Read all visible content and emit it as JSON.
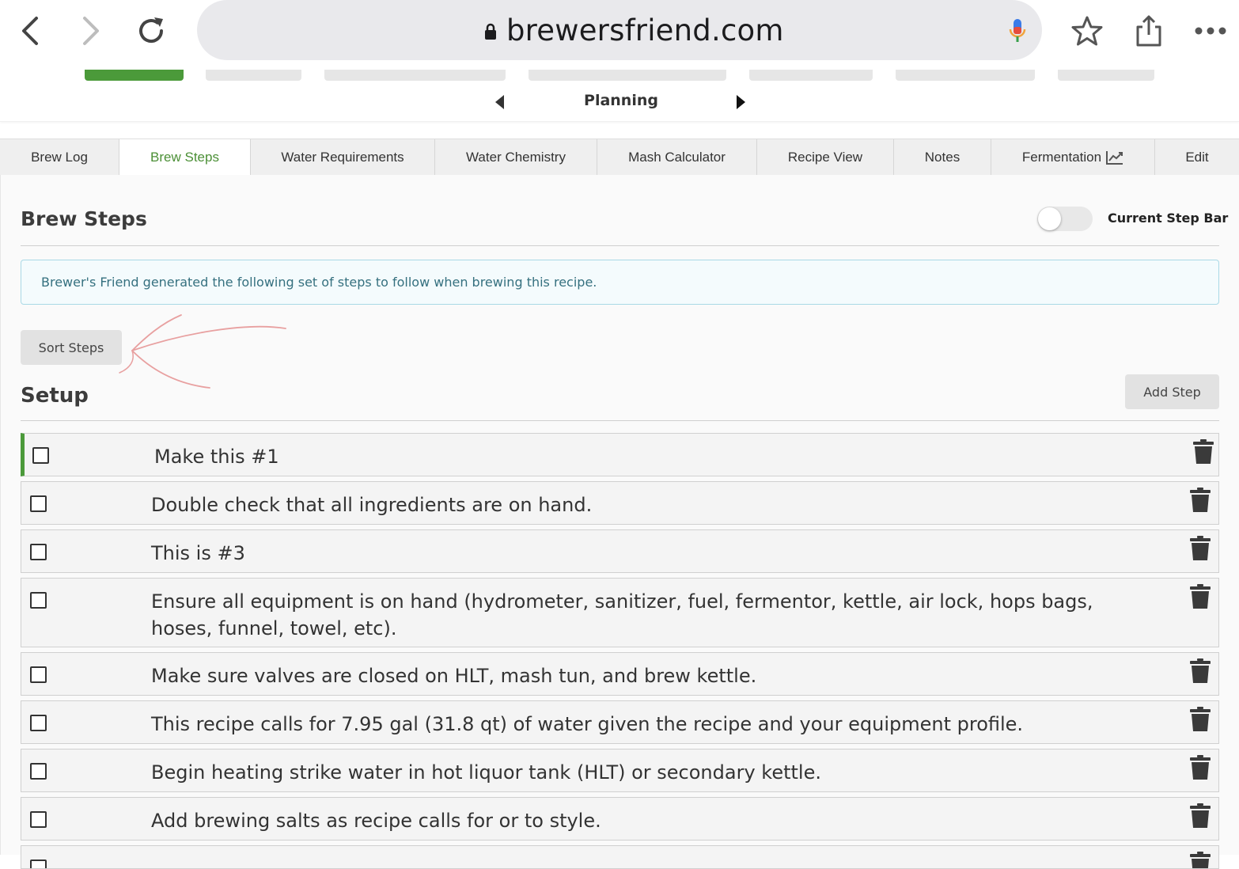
{
  "browser": {
    "url": "brewersfriend.com",
    "icons": [
      "back-icon",
      "forward-icon",
      "reload-icon",
      "lock-icon",
      "microphone-icon",
      "bookmark-star-icon",
      "share-icon",
      "more-icon"
    ]
  },
  "progress": {
    "current_stage": "Planning"
  },
  "tabs": [
    {
      "label": "Brew Log",
      "active": false
    },
    {
      "label": "Brew Steps",
      "active": true
    },
    {
      "label": "Water Requirements",
      "active": false
    },
    {
      "label": "Water Chemistry",
      "active": false
    },
    {
      "label": "Mash Calculator",
      "active": false
    },
    {
      "label": "Recipe View",
      "active": false
    },
    {
      "label": "Notes",
      "active": false
    },
    {
      "label": "Fermentation",
      "active": false,
      "icon": "chart-icon"
    },
    {
      "label": "Edit",
      "active": false
    }
  ],
  "page": {
    "title": "Brew Steps",
    "toggle_label": "Current Step Bar",
    "toggle_on": false,
    "info": "Brewer's Friend generated the following set of steps to follow when brewing this recipe.",
    "sort_button": "Sort Steps",
    "add_button": "Add Step",
    "section_title": "Setup"
  },
  "steps": [
    {
      "text": "Make this #1",
      "checked": false
    },
    {
      "text": "Double check that all ingredients are on hand.",
      "checked": false
    },
    {
      "text": "This is #3",
      "checked": false
    },
    {
      "text": "Ensure all equipment is on hand (hydrometer, sanitizer, fuel, fermentor, kettle, air lock, hops bags, hoses, funnel, towel, etc).",
      "checked": false
    },
    {
      "text": "Make sure valves are closed on HLT, mash tun, and brew kettle.",
      "checked": false
    },
    {
      "text": "This recipe calls for 7.95 gal (31.8 qt) of water given the recipe and your equipment profile.",
      "checked": false
    },
    {
      "text": "Begin heating strike water in hot liquor tank (HLT) or secondary kettle.",
      "checked": false
    },
    {
      "text": "Add brewing salts as recipe calls for or to style.",
      "checked": false
    }
  ],
  "colors": {
    "accent_green": "#4b9a3a",
    "tab_active_text": "#4b8f36",
    "info_border": "#a9d9e6",
    "info_text": "#35707f",
    "annotation_red": "#e8a0a0"
  }
}
